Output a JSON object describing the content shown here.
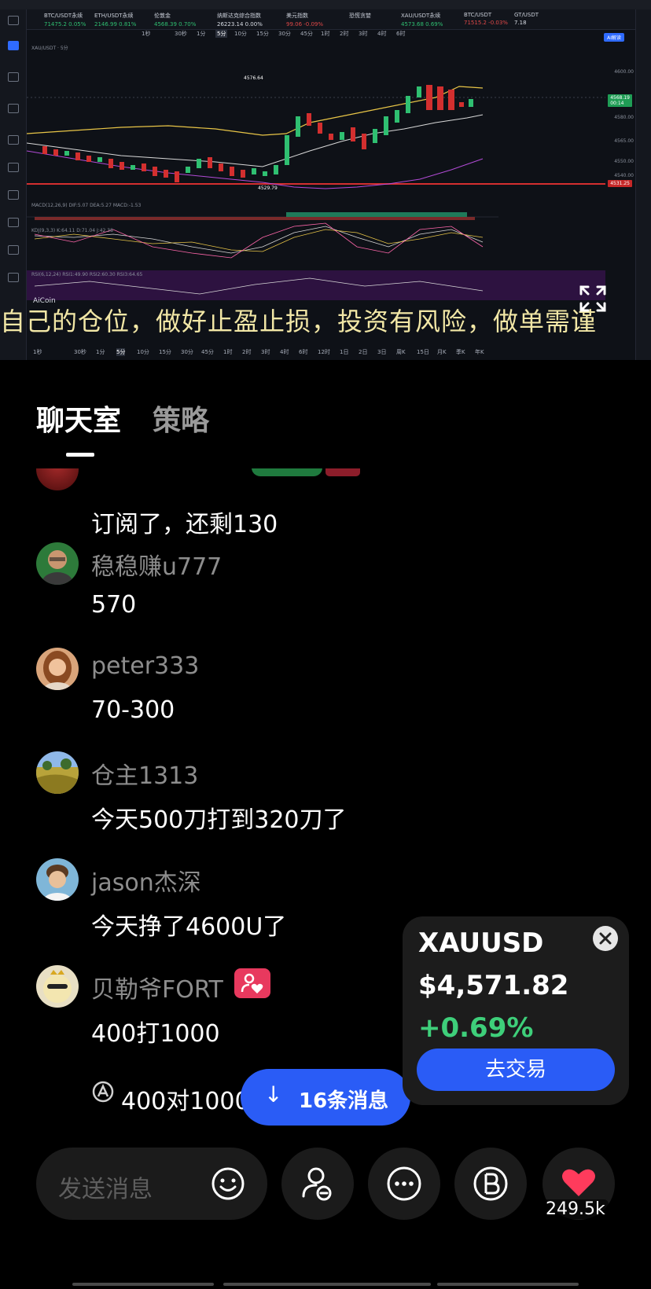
{
  "chart": {
    "tickers": [
      {
        "name": "BTC/USDT永续",
        "price": "71475.2 0.05%",
        "dir": "up"
      },
      {
        "name": "ETH/USDT永续",
        "price": "2146.99 0.81%",
        "dir": "up"
      },
      {
        "name": "伦敦金",
        "price": "4568.39 0.70%",
        "dir": "up"
      },
      {
        "name": "纳斯达克综合指数",
        "price": "26223.14 0.00%",
        "dir": "flat"
      },
      {
        "name": "美元指数",
        "price": "99.06 -0.09%",
        "dir": "dn"
      },
      {
        "name": "恐慌贪婪",
        "price": "",
        "dir": "flat"
      },
      {
        "name": "XAU/USDT永续",
        "price": "4573.68 0.69%",
        "dir": "up"
      },
      {
        "name": "BTC/USDT",
        "price": "71515.2 -0.03%",
        "dir": "dn"
      },
      {
        "name": "GT/USDT",
        "price": "7.18",
        "dir": "flat"
      }
    ],
    "ai_button": "AI解读",
    "intervals_top": [
      "1秒",
      "30秒",
      "1分",
      "5分",
      "10分",
      "15分",
      "30分",
      "45分",
      "1时",
      "2时",
      "3时",
      "4时",
      "6时"
    ],
    "selected_interval": "5分",
    "price_labels": [
      "4600.00",
      "4580.00",
      "4565.00",
      "4550.00",
      "4540.00"
    ],
    "last_price_tag": "4568.19",
    "last_price_sub": "00:14",
    "support_tag": "4531.25",
    "high_label": "4576.64",
    "low_label": "4529.79",
    "macd_label": "MACD(12,26,9)  DIF:5.07  DEA:5.27  MACD:-1.53",
    "kdj_label": "KDJ(9,3,3)  K:64.11  D:71.04  J:42.38",
    "rsi_label": "RSI(6,12,24)  RSI1:49.90  RSI2:60.30  RSI3:64.65",
    "marquee": "自己的仓位，做好止盈止损，投资有风险，做单需谨",
    "brand": "AiCoin",
    "intervals_bottom": [
      "1秒",
      "30秒",
      "1分",
      "5分",
      "10分",
      "15分",
      "30分",
      "45分",
      "1时",
      "2时",
      "3时",
      "4时",
      "6时",
      "12时",
      "1日",
      "2日",
      "3日",
      "周K",
      "15日",
      "月K",
      "季K",
      "年K"
    ]
  },
  "tabs": {
    "chat": "聊天室",
    "strategy": "策略"
  },
  "messages": [
    {
      "text": "订阅了，还剩130"
    },
    {
      "user": "稳稳赚u777",
      "text": "570"
    },
    {
      "user": "peter333",
      "text": "70-300"
    },
    {
      "user": "仓主1313",
      "text": "今天500刀打到320刀了"
    },
    {
      "user": "jason杰深",
      "text": "今天挣了4600U了"
    },
    {
      "user": "贝勒爷FORT",
      "text": "400打1000"
    }
  ],
  "reply": {
    "text": "400对1000"
  },
  "new_messages": {
    "label": "16条消息"
  },
  "quote": {
    "symbol": "XAUUSD",
    "price": "$4,571.82",
    "change": "+0.69%",
    "trade": "去交易"
  },
  "input": {
    "placeholder": "发送消息"
  },
  "likes": "249.5k",
  "colors": {
    "accent": "#2a5cf6",
    "up": "#3ecf7a",
    "like": "#ff3b5c"
  }
}
